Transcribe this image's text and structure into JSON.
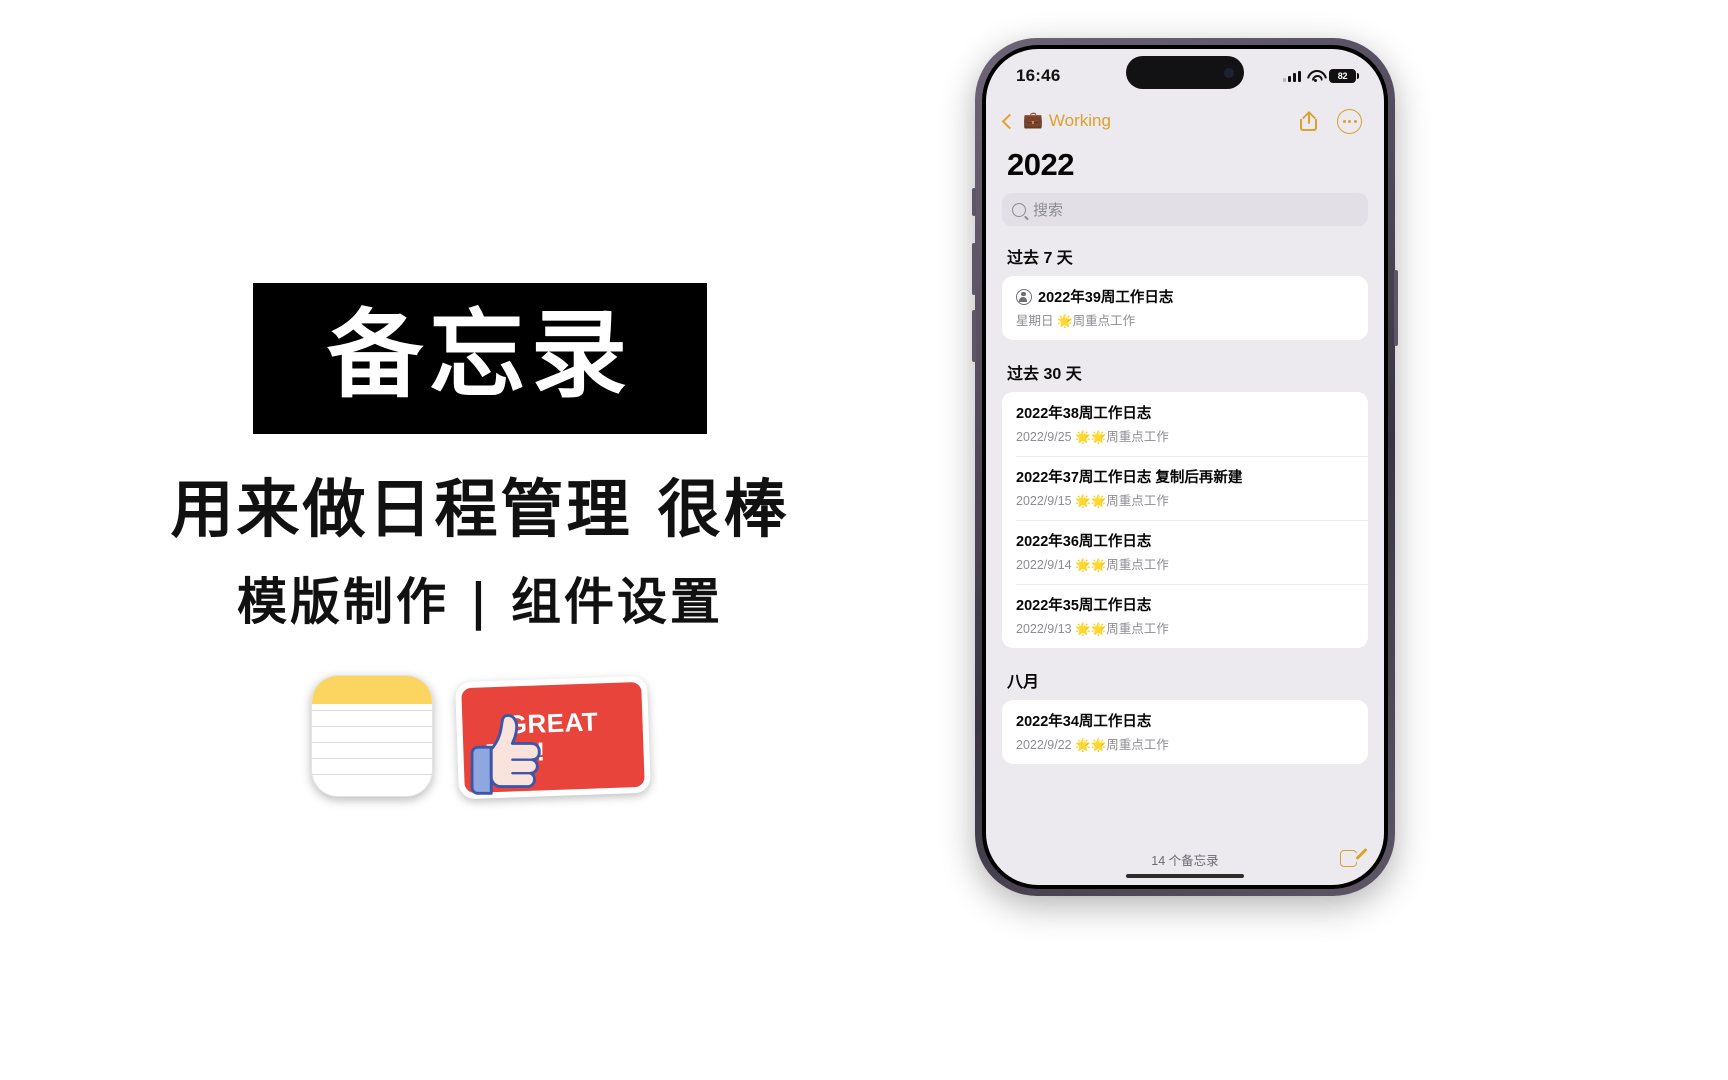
{
  "promo": {
    "title": "备忘录",
    "subtitle_1": "用来做日程管理 很棒",
    "subtitle_2": "模版制作 | 组件设置",
    "notes_app_icon": "notes-app-icon",
    "sticker_line_1": "GREAT",
    "sticker_line_2": "JOB!",
    "sticker_emoji": "👍"
  },
  "phone": {
    "statusbar": {
      "time": "16:46",
      "cellular": "signal-bars-icon",
      "wifi": "wifi-icon",
      "battery_level": "82"
    },
    "navbar": {
      "back_label": "Working",
      "folder_emoji": "💼",
      "share": "share-icon",
      "more": "more-options-icon"
    },
    "page_title": "2022",
    "search": {
      "placeholder": "搜索",
      "icon": "search-icon"
    },
    "sections": [
      {
        "header": "过去 7 天",
        "notes": [
          {
            "title": "2022年39周工作日志",
            "subtitle_date": "星期日",
            "subtitle_stars": "🌟",
            "subtitle_text": "周重点工作",
            "shared": true
          }
        ]
      },
      {
        "header": "过去 30 天",
        "notes": [
          {
            "title": "2022年38周工作日志",
            "subtitle_date": "2022/9/25",
            "subtitle_stars": "🌟🌟",
            "subtitle_text": "周重点工作",
            "shared": false
          },
          {
            "title": "2022年37周工作日志 复制后再新建",
            "subtitle_date": "2022/9/15",
            "subtitle_stars": "🌟🌟",
            "subtitle_text": "周重点工作",
            "shared": false
          },
          {
            "title": "2022年36周工作日志",
            "subtitle_date": "2022/9/14",
            "subtitle_stars": "🌟🌟",
            "subtitle_text": "周重点工作",
            "shared": false
          },
          {
            "title": "2022年35周工作日志",
            "subtitle_date": "2022/9/13",
            "subtitle_stars": "🌟🌟",
            "subtitle_text": "周重点工作",
            "shared": false
          }
        ]
      },
      {
        "header": "八月",
        "notes": [
          {
            "title": "2022年34周工作日志",
            "subtitle_date": "2022/9/22",
            "subtitle_stars": "🌟🌟",
            "subtitle_text": "周重点工作",
            "shared": false
          }
        ]
      }
    ],
    "toolbar": {
      "count_label": "14 个备忘录",
      "compose": "compose-note-icon"
    }
  },
  "colors": {
    "accent": "#d9a22c",
    "sticker_red": "#e8443c",
    "screen_bg": "#eceaef",
    "card_bg": "#ffffff"
  }
}
